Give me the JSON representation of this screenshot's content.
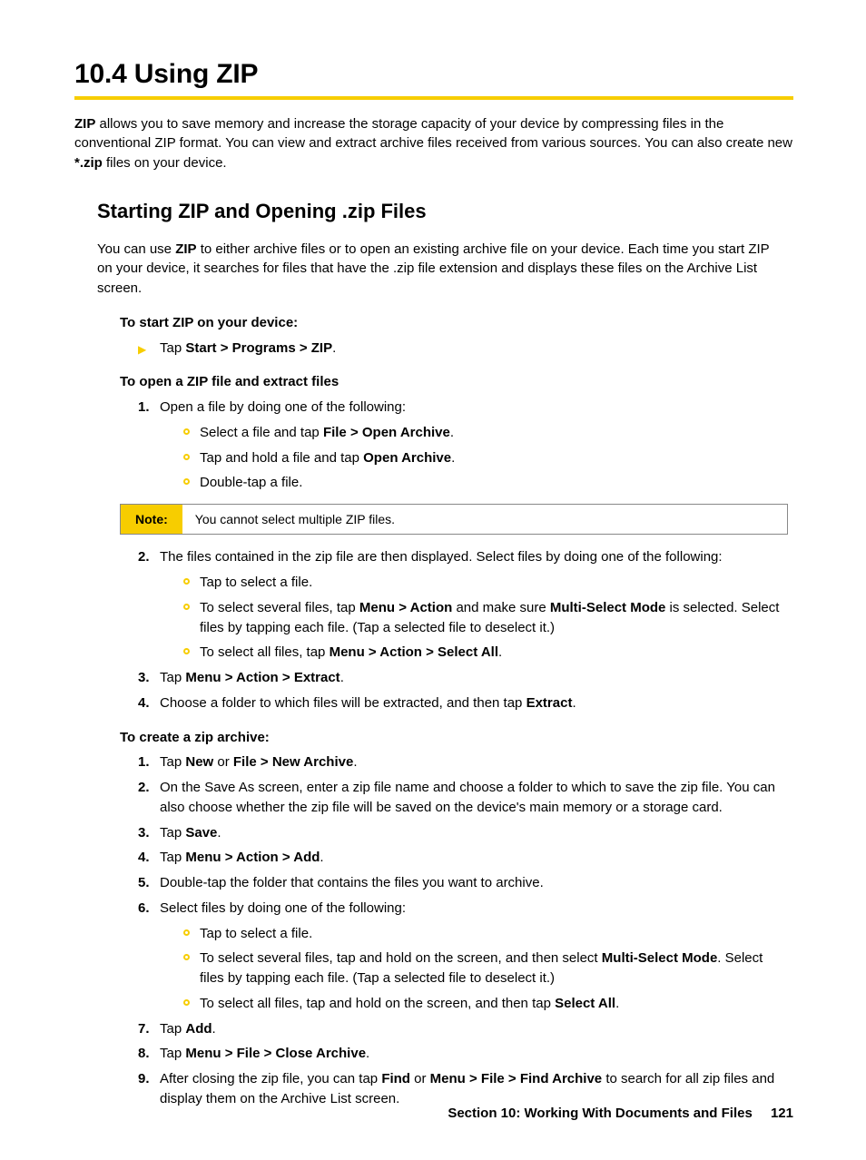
{
  "heading": {
    "number": "10.4",
    "title": "Using ZIP"
  },
  "intro": {
    "lead_bold": "ZIP",
    "text_1": " allows you to save memory and increase the storage capacity of your device by compressing files in the conventional ZIP format. You can view and extract archive files received from various sources. You can also create new ",
    "file_bold": "*.zip",
    "text_2": " files on your device."
  },
  "subheading": "Starting ZIP and Opening .zip Files",
  "sub_intro": {
    "a": "You can use ",
    "b": "ZIP",
    "c": " to either archive files or to open an existing archive file on your device. Each time you start ZIP on your device, it searches for files that have the .zip file extension and displays these files on the Archive List screen."
  },
  "proc1": {
    "title": "To start ZIP on your device:",
    "step": {
      "a": "Tap ",
      "b": "Start > Programs > ZIP",
      "c": "."
    }
  },
  "proc2": {
    "title": "To open a ZIP file and extract files",
    "step1": "Open a file by doing one of the following:",
    "s1_bullets": [
      {
        "a": "Select a file and tap ",
        "b": "File > Open Archive",
        "c": "."
      },
      {
        "a": "Tap and hold a file and tap ",
        "b": "Open Archive",
        "c": "."
      },
      {
        "a": "Double-tap a file.",
        "b": "",
        "c": ""
      }
    ],
    "note_label": "Note:",
    "note_text": "You cannot select multiple ZIP files.",
    "step2": "The files contained in the zip file are then displayed. Select files by doing one of the following:",
    "s2_bullets": {
      "b1": "Tap to select a file.",
      "b2": {
        "a": "To select several files, tap ",
        "b": "Menu > Action",
        "c": " and make sure ",
        "d": "Multi-Select Mode",
        "e": " is selected. Select files by tapping each file. (Tap a selected file to deselect it.)"
      },
      "b3": {
        "a": "To select all files, tap ",
        "b": "Menu > Action > Select All",
        "c": "."
      }
    },
    "step3": {
      "a": "Tap ",
      "b": "Menu > Action > Extract",
      "c": "."
    },
    "step4": {
      "a": "Choose a folder to which files will be extracted, and then tap ",
      "b": "Extract",
      "c": "."
    }
  },
  "proc3": {
    "title": "To create a zip archive:",
    "step1": {
      "a": "Tap ",
      "b": "New",
      "c": " or ",
      "d": "File > New Archive",
      "e": "."
    },
    "step2": "On the Save As screen, enter a zip file name and choose a folder to which to save the zip file. You can also choose whether the zip file will be saved on the device's main memory or a storage card.",
    "step3": {
      "a": "Tap ",
      "b": "Save",
      "c": "."
    },
    "step4": {
      "a": "Tap ",
      "b": "Menu > Action > Add",
      "c": "."
    },
    "step5": "Double-tap the folder that contains the files you want to archive.",
    "step6": "Select files by doing one of the following:",
    "s6_bullets": {
      "b1": "Tap to select a file.",
      "b2": {
        "a": "To select several files, tap and hold on the screen, and then select ",
        "b": "Multi-Select Mode",
        "c": ". Select files by tapping each file. (Tap a selected file to deselect it.)"
      },
      "b3": {
        "a": "To select all files, tap and hold on the screen, and then tap ",
        "b": "Select All",
        "c": "."
      }
    },
    "step7": {
      "a": "Tap ",
      "b": "Add",
      "c": "."
    },
    "step8": {
      "a": "Tap ",
      "b": "Menu > File > Close Archive",
      "c": "."
    },
    "step9": {
      "a": "After closing the zip file, you can tap ",
      "b": "Find",
      "c": " or ",
      "d": "Menu > File > Find Archive",
      "e": " to search for all zip files and display them on the Archive List screen."
    }
  },
  "footer": {
    "section": "Section 10: Working With Documents and Files",
    "page": "121"
  }
}
